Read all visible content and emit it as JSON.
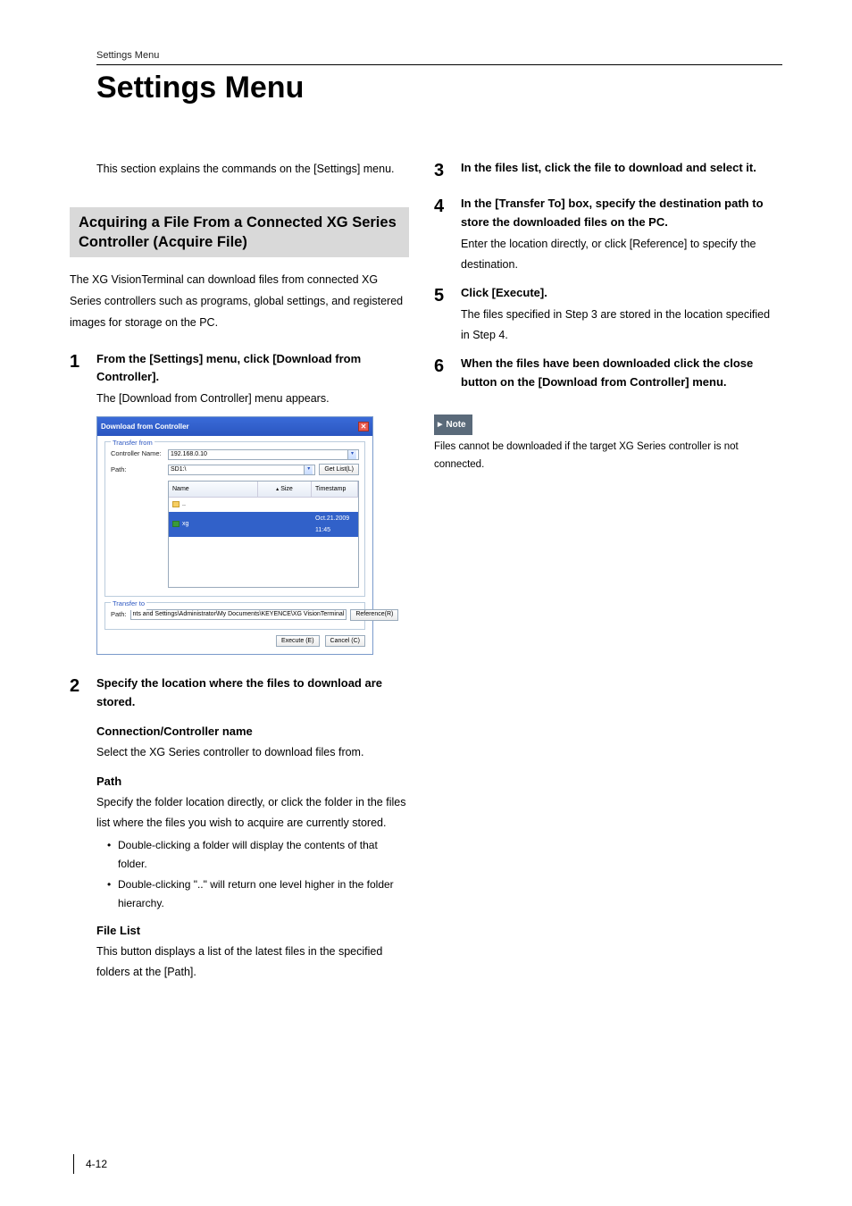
{
  "header": {
    "crumb": "Settings Menu"
  },
  "title": "Settings Menu",
  "left": {
    "intro": "This section explains the commands on the [Settings] menu.",
    "section_bar": "Acquiring a File From a Connected XG Series Controller (Acquire File)",
    "section_desc": "The XG VisionTerminal can download files from connected XG Series controllers such as programs, global settings, and registered images for storage on the PC.",
    "step1_head": "From the [Settings] menu, click [Download from Controller].",
    "step1_text": "The [Download from Controller] menu appears.",
    "step2_head": "Specify the location where the files to download are stored.",
    "sub_conn_head": "Connection/Controller name",
    "sub_conn_text": "Select the XG Series controller to download files from.",
    "sub_path_head": "Path",
    "sub_path_text": "Specify the folder location directly, or click the folder in the files list where the files you wish to acquire are currently stored.",
    "bullet_a": "Double-clicking a folder will display the contents of that folder.",
    "bullet_b": "Double-clicking \"..\" will return one level higher in the folder hierarchy.",
    "sub_fl_head": "File List",
    "sub_fl_text": "This button displays a list of the latest files in the specified folders at the [Path]."
  },
  "dialog": {
    "title": "Download from Controller",
    "legend_from": "Transfer from",
    "lbl_controller": "Controller Name:",
    "val_controller": "192.168.0.10",
    "lbl_path": "Path:",
    "val_path": "SD1:\\",
    "btn_getlist": "Get List(L)",
    "col_name": "Name",
    "col_size": "Size",
    "col_time": "Timestamp",
    "row_up": "..",
    "row_xg": "xg",
    "row_xg_time": "Oct.21.2009 11:45",
    "legend_to": "Transfer to",
    "val_to": "nts and Settings\\Administrator\\My Documents\\KEYENCE\\XG VisionTerminal",
    "btn_ref": "Reference(R)",
    "btn_exec": "Execute (E)",
    "btn_cancel": "Cancel (C)"
  },
  "right": {
    "step3_head": "In the files list, click the file to download and select it.",
    "step4_head": "In the [Transfer To] box, specify the destination path to store the downloaded files on the PC.",
    "step4_text": "Enter the location directly, or click [Reference] to specify the destination.",
    "step5_head": "Click [Execute].",
    "step5_text": "The files specified in Step 3 are stored in the location specified in Step 4.",
    "step6_head": "When the files have been downloaded click the close button on the [Download from Controller] menu.",
    "note_label": "Note",
    "note_text": "Files cannot be downloaded if the target XG Series controller is not connected."
  },
  "footer": {
    "page": "4-12"
  },
  "nums": {
    "n1": "1",
    "n2": "2",
    "n3": "3",
    "n4": "4",
    "n5": "5",
    "n6": "6"
  }
}
